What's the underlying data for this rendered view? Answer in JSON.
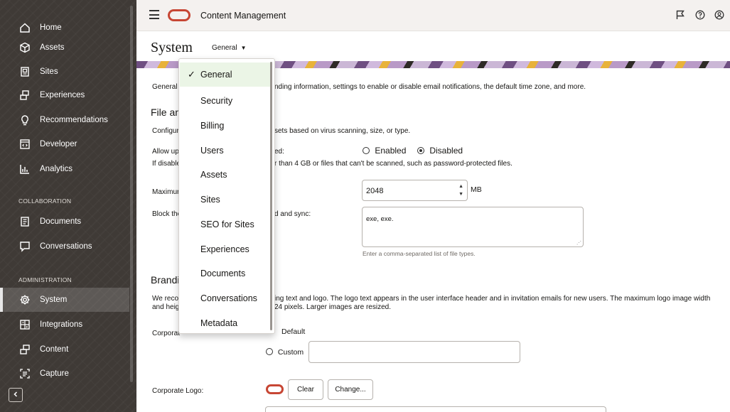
{
  "sidebar": {
    "items": [
      {
        "label": "Home",
        "icon": "home-icon"
      },
      {
        "label": "Assets",
        "icon": "assets-icon"
      },
      {
        "label": "Sites",
        "icon": "sites-icon"
      },
      {
        "label": "Experiences",
        "icon": "experiences-icon"
      },
      {
        "label": "Recommendations",
        "icon": "recommendations-icon"
      },
      {
        "label": "Developer",
        "icon": "developer-icon"
      },
      {
        "label": "Analytics",
        "icon": "analytics-icon"
      }
    ],
    "collaboration_heading": "COLLABORATION",
    "collaboration_items": [
      {
        "label": "Documents",
        "icon": "documents-icon"
      },
      {
        "label": "Conversations",
        "icon": "conversations-icon"
      }
    ],
    "administration_heading": "ADMINISTRATION",
    "administration_items": [
      {
        "label": "System",
        "icon": "system-gear-icon",
        "active": true
      },
      {
        "label": "Integrations",
        "icon": "integrations-icon"
      },
      {
        "label": "Content",
        "icon": "content-icon"
      },
      {
        "label": "Capture",
        "icon": "capture-icon"
      }
    ],
    "collapse_icon": "chevron-left-icon"
  },
  "header": {
    "app_title": "Content Management",
    "icons": [
      "flag-icon",
      "help-icon",
      "user-icon"
    ],
    "brand_color": "#c74634"
  },
  "page": {
    "title": "System",
    "section_selector": "General",
    "intro_prefix": "General s",
    "intro_suffix": "nding information, settings to enable or disable email notifications, the default time zone, and more."
  },
  "file_section": {
    "heading": "File an",
    "config_prefix": "Configur",
    "config_suffix": "sets based on virus scanning, size, or type.",
    "allow_prefix": "Allow up",
    "allow_suffix": "ed:",
    "allow_options": {
      "enabled": "Enabled",
      "disabled": "Disabled",
      "selected": "Disabled"
    },
    "if_disabled_prefix": "If disable",
    "if_disabled_suffix": "r than 4 GB or files that can't be scanned, such as password-protected files.",
    "max_prefix": "Maximur",
    "max_value": "2048",
    "max_unit": "MB",
    "block_prefix": "Block the",
    "block_suffix": "d and sync:",
    "block_value": "exe, exe.",
    "block_hint": "Enter a comma-separated list of file types."
  },
  "branding_section": {
    "heading": "Brandi",
    "rec_prefix_1": "We recon",
    "rec_prefix_2": "and heig",
    "rec_suffix_1": "ing text and logo. The logo text appears in the user interface header and in invitation emails for new users. The maximum logo image width",
    "rec_suffix_2": "24 pixels. Larger images are resized.",
    "corporate_prefix": "Corporat",
    "default_label": "Default",
    "custom_label": "Custom",
    "logo_label": "Corporate Logo:",
    "clear_button": "Clear",
    "change_button": "Change..."
  },
  "dropdown": {
    "items": [
      "General",
      "Security",
      "Billing",
      "Users",
      "Assets",
      "Sites",
      "SEO for Sites",
      "Experiences",
      "Documents",
      "Conversations",
      "Metadata"
    ],
    "selected": "General"
  }
}
